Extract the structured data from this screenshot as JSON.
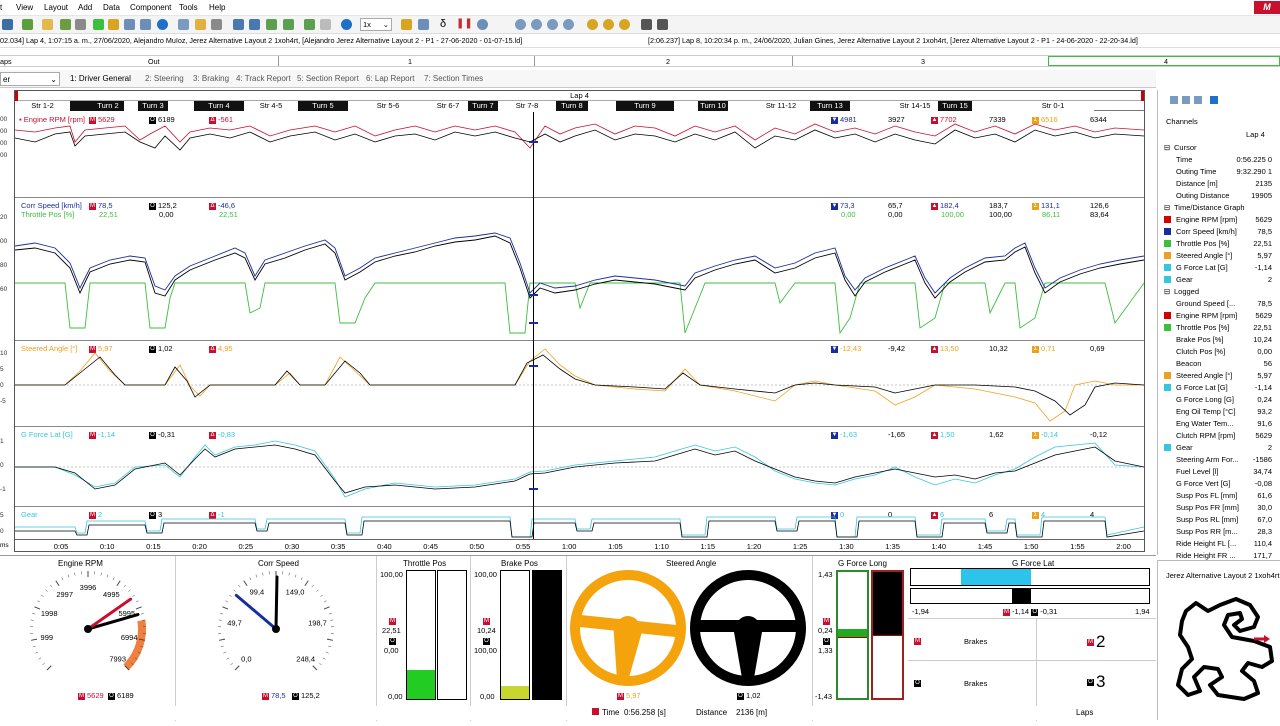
{
  "menu": [
    "t",
    "View",
    "Layout",
    "Add",
    "Data",
    "Component",
    "Tools",
    "Help"
  ],
  "zoom_select": "1x",
  "info": {
    "left": "02.034] Lap 4, 1:07:15 a. m., 27/06/2020, Alejandro Muïoz, Jerez Alternative Layout 2 1xoh4rt,  [Alejandro Jerez Alternative Layout 2 - P1 - 27-06-2020 - 01-07-15.ld]",
    "right": "[2:06.237] Lap 8, 10:20:34 p. m., 24/06/2020, Julian Gines, Jerez Alternative Layout 2 1xoh4rt,  [Jerez Alternative Layout 2 - P1 - 24-06-2020 - 22-20-34.ld]"
  },
  "laps": {
    "label": "aps",
    "out": "Out",
    "n1": "1",
    "n2": "2",
    "n3": "3",
    "n4": "4"
  },
  "tabs": {
    "dropdown": "er",
    "items": [
      "1: Driver General",
      "2: Steering",
      "3: Braking",
      "4: Track Report",
      "5: Section Report",
      "6: Lap Report",
      "7: Section Times"
    ]
  },
  "graph": {
    "lap_title": "Lap 4",
    "segments": [
      {
        "label": "Str 1-2",
        "dark": false
      },
      {
        "label": "",
        "dark": true
      },
      {
        "label": "Turn 2",
        "dark": true
      },
      {
        "label": "",
        "dark": false
      },
      {
        "label": "Turn 3",
        "dark": true
      },
      {
        "label": "",
        "dark": false
      },
      {
        "label": "Turn 4",
        "dark": true
      },
      {
        "label": "Str 4-5",
        "dark": false
      },
      {
        "label": "Turn 5",
        "dark": true
      },
      {
        "label": "Str 5-6",
        "dark": false
      },
      {
        "label": "Str 6-7",
        "dark": false
      },
      {
        "label": "Turn 7",
        "dark": true
      },
      {
        "label": "Str 7-8",
        "dark": false
      },
      {
        "label": "Turn 8",
        "dark": true
      },
      {
        "label": "",
        "dark": false
      },
      {
        "label": "Turn 9",
        "dark": true
      },
      {
        "label": "",
        "dark": false
      },
      {
        "label": "Turn 10",
        "dark": true
      },
      {
        "label": "",
        "dark": false
      },
      {
        "label": "Str 11-12",
        "dark": false
      },
      {
        "label": "Turn 13",
        "dark": true
      },
      {
        "label": "",
        "dark": false
      },
      {
        "label": "Str 14-15",
        "dark": false
      },
      {
        "label": "Turn 15",
        "dark": true
      },
      {
        "label": "",
        "dark": false
      },
      {
        "label": "Str 0-1",
        "dark": false
      }
    ],
    "panels": {
      "rpm": {
        "label": "Engine RPM [rpm]",
        "m": "5629",
        "o": "6189",
        "d": "-561",
        "min_v": "4981",
        "min_r": "3927",
        "max_v": "7702",
        "max_r": "7339",
        "avg_v": "6516",
        "avg_r": "6344"
      },
      "speed": {
        "label": "Corr Speed [km/h]",
        "label2": "Throttle Pos [%]",
        "m": "78,5",
        "o": "125,2",
        "d": "-46,6",
        "m2": "22,51",
        "o2": "0,00",
        "d2": "22,51",
        "min_v": "73,3",
        "min_r": "65,7",
        "max_v": "182,4",
        "max_r": "183,7",
        "avg_v": "131,1",
        "avg_r": "126,6",
        "min_v2": "0,00",
        "min_r2": "0,00",
        "max_v2": "100,00",
        "max_r2": "100,00",
        "avg_v2": "86,11",
        "avg_r2": "83,64"
      },
      "steer": {
        "label": "Steered Angle [°]",
        "m": "5,97",
        "o": "1,02",
        "d": "4,95",
        "min_v": "-12,43",
        "min_r": "-9,42",
        "max_v": "13,50",
        "max_r": "10,32",
        "avg_v": "0,71",
        "avg_r": "0,69"
      },
      "glat": {
        "label": "G Force Lat [G]",
        "m": "-1,14",
        "o": "-0,31",
        "d": "-0,83",
        "min_v": "-1,63",
        "min_r": "-1,65",
        "max_v": "1,50",
        "max_r": "1,62",
        "avg_v": "-0,14",
        "avg_r": "-0,12"
      },
      "gear": {
        "label": "Gear",
        "m": "2",
        "o": "3",
        "d": "-1",
        "min_v": "0",
        "min_r": "0",
        "max_v": "6",
        "max_r": "6",
        "avg_v": "4",
        "avg_r": "4"
      }
    },
    "time_ticks": [
      "0:05",
      "0:10",
      "0:15",
      "0:20",
      "0:25",
      "0:30",
      "0:35",
      "0:40",
      "0:45",
      "0:50",
      "0:55",
      "1:00",
      "1:05",
      "1:10",
      "1:15",
      "1:20",
      "1:25",
      "1:30",
      "1:35",
      "1:40",
      "1:45",
      "1:50",
      "1:55",
      "2:00"
    ],
    "x_unit": "ms"
  },
  "sidebar": {
    "title": "Channels",
    "lap": "Lap 4",
    "rows": [
      {
        "label": "Cursor",
        "value": "",
        "group": true
      },
      {
        "label": "Time",
        "value": "0:56.225 0",
        "color": ""
      },
      {
        "label": "Outing Time",
        "value": "9:32.290 1",
        "color": ""
      },
      {
        "label": "Distance [m]",
        "value": "2135",
        "color": ""
      },
      {
        "label": "Outing Distance",
        "value": "19905",
        "color": ""
      },
      {
        "label": "Time/Distance Graph",
        "value": "",
        "group": true
      },
      {
        "label": "Engine RPM [rpm]",
        "value": "5629",
        "color": "#d40000"
      },
      {
        "label": "Corr Speed [km/h]",
        "value": "78,5",
        "color": "#1a2d9e"
      },
      {
        "label": "Throttle Pos [%]",
        "value": "22,51",
        "color": "#3cbf3c"
      },
      {
        "label": "Steered Angle [°]",
        "value": "5,97",
        "color": "#f0a020"
      },
      {
        "label": "G Force Lat [G]",
        "value": "-1,14",
        "color": "#35c6e0"
      },
      {
        "label": "Gear",
        "value": "2",
        "color": "#35c6e0"
      },
      {
        "label": "Logged",
        "value": "",
        "group": true
      },
      {
        "label": "Ground Speed [...",
        "value": "78,5",
        "color": ""
      },
      {
        "label": "Engine RPM [rpm]",
        "value": "5629",
        "color": "#d40000"
      },
      {
        "label": "Throttle Pos [%]",
        "value": "22,51",
        "color": "#3cbf3c"
      },
      {
        "label": "Brake Pos [%]",
        "value": "10,24",
        "color": ""
      },
      {
        "label": "Clutch Pos [%]",
        "value": "0,00",
        "color": ""
      },
      {
        "label": "Beacon",
        "value": "56",
        "color": ""
      },
      {
        "label": "Steered Angle [°]",
        "value": "5,97",
        "color": "#f0a020"
      },
      {
        "label": "G Force Lat [G]",
        "value": "-1,14",
        "color": "#35c6e0"
      },
      {
        "label": "G Force Long [G]",
        "value": "0,24",
        "color": ""
      },
      {
        "label": "Eng Oil Temp [°C]",
        "value": "93,2",
        "color": ""
      },
      {
        "label": "Eng Water Tem...",
        "value": "91,6",
        "color": ""
      },
      {
        "label": "Clutch RPM [rpm]",
        "value": "5629",
        "color": ""
      },
      {
        "label": "Gear",
        "value": "2",
        "color": "#35c6e0"
      },
      {
        "label": "Steering Arm For...",
        "value": "-1586",
        "color": ""
      },
      {
        "label": "Fuel Level [l]",
        "value": "34,74",
        "color": ""
      },
      {
        "label": "G Force Vert [G]",
        "value": "-0,08",
        "color": ""
      },
      {
        "label": "Susp Pos FL [mm]",
        "value": "61,6",
        "color": ""
      },
      {
        "label": "Susp Pos FR [mm]",
        "value": "30,0",
        "color": ""
      },
      {
        "label": "Susp Pos RL [mm]",
        "value": "67,0",
        "color": ""
      },
      {
        "label": "Susp Pos RR [m...",
        "value": "28,3",
        "color": ""
      },
      {
        "label": "Ride Height FL [...",
        "value": "110,4",
        "color": ""
      },
      {
        "label": "Ride Height FR ...",
        "value": "171,7",
        "color": ""
      }
    ]
  },
  "gauges": {
    "rpm": {
      "title": "Engine RPM",
      "ticks": [
        "999",
        "1998",
        "2997",
        "3996",
        "4995",
        "5995",
        "6994",
        "7993"
      ],
      "m": "5629",
      "o": "6189",
      "value": 5629,
      "ref": 6189,
      "max": 8000
    },
    "speed": {
      "title": "Corr Speed",
      "ticks": [
        "0,0",
        "49,7",
        "99,4",
        "149,0",
        "198,7",
        "248,4"
      ],
      "m": "78,5",
      "o": "125,2",
      "value": 78.5,
      "ref": 125.2,
      "max": 248.4
    },
    "throttle": {
      "title": "Throttle Pos",
      "top": "100,00",
      "m": "22,51",
      "o": "0,00",
      "bottom": "0,00",
      "value": 22.51,
      "ref": 0
    },
    "brake": {
      "title": "Brake Pos",
      "top": "100,00",
      "m": "10,24",
      "o": "100,00",
      "bottom": "0,00",
      "value": 10.24,
      "ref": 100
    },
    "steer": {
      "title": "Steered Angle",
      "m": "5,97",
      "o": "1,02"
    },
    "glong": {
      "title": "G Force Long",
      "top": "1,43",
      "m": "0,24",
      "o": "1,33",
      "bottom": "-1,43"
    },
    "glat": {
      "title": "G Force Lat",
      "min": "-1,94",
      "max": "1,94",
      "m": "-1,14",
      "o": "-0,31"
    },
    "brakes": {
      "label1": "Brakes",
      "label2": "Brakes",
      "gear_m": "2",
      "gear_o": "3"
    }
  },
  "track_map": {
    "title": "Jerez Alternative Layout 2 1xoh4rt"
  },
  "status": {
    "time_label": "Time",
    "time_value": "0:56.258 [s]",
    "distance_label": "Distance",
    "distance_value": "2136 [m]",
    "laps_label": "Laps"
  }
}
